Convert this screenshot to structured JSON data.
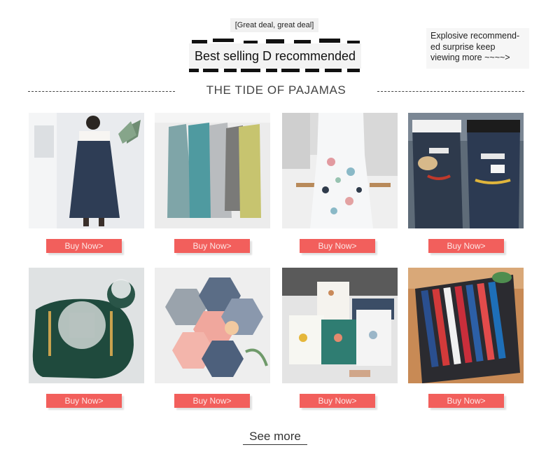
{
  "header": {
    "tag": "[Great deal, great deal]",
    "banner": "Best selling D recommended",
    "side_note": "Explosive recommend-ed surprise keep viewing more ~~~~>",
    "section_title": "THE TIDE OF PAJAMAS"
  },
  "products": [
    {
      "image": "apron-woman-navy",
      "buy_label": "Buy Now>"
    },
    {
      "image": "aprons-hanging-colors",
      "buy_label": "Buy Now>"
    },
    {
      "image": "apron-dotted-white",
      "buy_label": "Buy Now>"
    },
    {
      "image": "aprons-peace-couple",
      "buy_label": "Buy Now>"
    },
    {
      "image": "placemat-green",
      "buy_label": "Buy Now>"
    },
    {
      "image": "hexagon-trivets",
      "buy_label": "Buy Now>"
    },
    {
      "image": "lunch-bags",
      "buy_label": "Buy Now>"
    },
    {
      "image": "chopsticks-set",
      "buy_label": "Buy Now>"
    }
  ],
  "footer": {
    "see_more": "See more"
  },
  "colors": {
    "button": "#f25f5c",
    "button_text": "#fde7e6"
  }
}
